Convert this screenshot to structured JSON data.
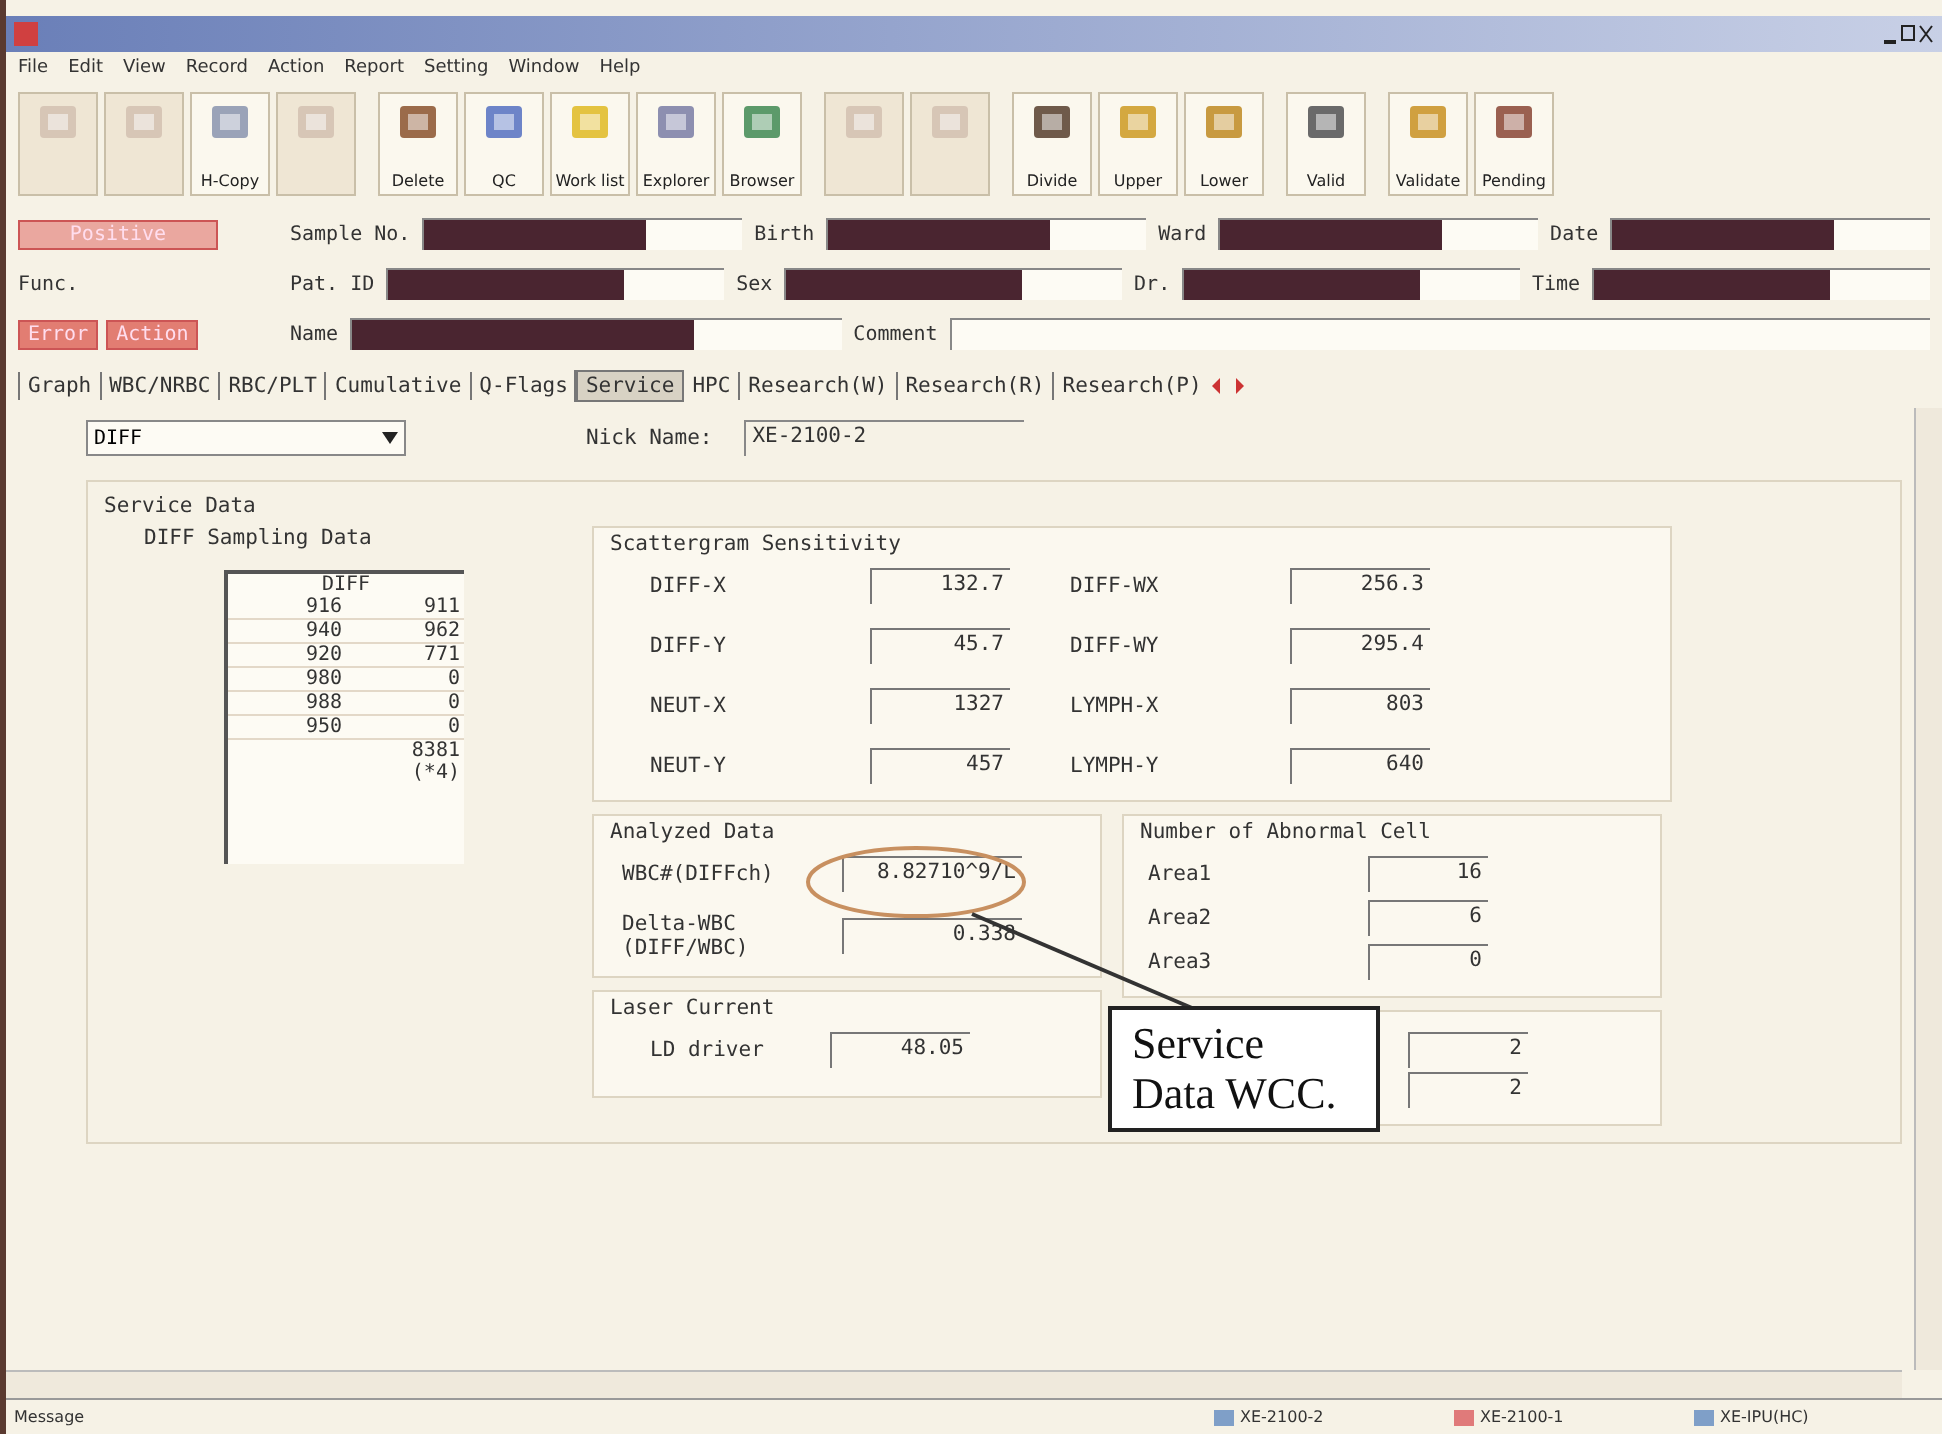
{
  "menu": [
    "File",
    "Edit",
    "View",
    "Record",
    "Action",
    "Report",
    "Setting",
    "Window",
    "Help"
  ],
  "toolbar": [
    {
      "disabled": true
    },
    {
      "disabled": true
    },
    {
      "label": "H-Copy",
      "disabled": false
    },
    {
      "disabled": true
    },
    {
      "label": "Delete",
      "disabled": false
    },
    {
      "label": "QC",
      "disabled": false
    },
    {
      "label": "Work list",
      "disabled": false
    },
    {
      "label": "Explorer",
      "disabled": false
    },
    {
      "label": "Browser",
      "disabled": false
    },
    {
      "disabled": true
    },
    {
      "disabled": true
    },
    {
      "label": "Divide",
      "disabled": false
    },
    {
      "label": "Upper",
      "disabled": false
    },
    {
      "label": "Lower",
      "disabled": false
    },
    {
      "label": "Valid",
      "disabled": false
    },
    {
      "label": "Validate",
      "disabled": false
    },
    {
      "label": "Pending",
      "disabled": false
    }
  ],
  "status_flag": "Positive",
  "func_label": "Func.",
  "action_buttons": [
    "Error",
    "Action"
  ],
  "header_rows": [
    [
      {
        "label": "Sample No.",
        "redacted": true
      },
      {
        "label": "Birth",
        "redacted": true
      },
      {
        "label": "Ward",
        "redacted": true
      },
      {
        "label": "Date",
        "redacted": true
      }
    ],
    [
      {
        "label": "Pat. ID",
        "redacted": true
      },
      {
        "label": "Sex",
        "redacted": true
      },
      {
        "label": "Dr.",
        "redacted": true
      },
      {
        "label": "Time",
        "redacted": true
      }
    ],
    [
      {
        "label": "Name",
        "redacted": true
      },
      {
        "label": "Comment",
        "redacted": false
      }
    ]
  ],
  "tabs": [
    {
      "label": "Graph",
      "selected": false
    },
    {
      "label": "WBC/NRBC",
      "selected": false
    },
    {
      "label": "RBC/PLT",
      "selected": false
    },
    {
      "label": "Cumulative",
      "selected": false
    },
    {
      "label": "Q-Flags",
      "selected": false
    },
    {
      "label": "Service",
      "selected": true
    },
    {
      "label": "HPC",
      "selected": false
    },
    {
      "label": "Research(W)",
      "selected": false
    },
    {
      "label": "Research(R)",
      "selected": false
    },
    {
      "label": "Research(P)",
      "selected": false
    }
  ],
  "channel_select": {
    "value": "DIFF"
  },
  "nick_name": {
    "label": "Nick Name:",
    "value": "XE-2100-2"
  },
  "service": {
    "title": "Service Data",
    "sampling": {
      "title": "DIFF Sampling Data",
      "header": "DIFF",
      "rows": [
        [
          "916",
          "911"
        ],
        [
          "940",
          "962"
        ],
        [
          "920",
          "771"
        ],
        [
          "980",
          "0"
        ],
        [
          "988",
          "0"
        ],
        [
          "950",
          "0"
        ]
      ],
      "total": "8381",
      "note": "(*4)"
    },
    "scattergram": {
      "title": "Scattergram Sensitivity",
      "fields": [
        {
          "label": "DIFF-X",
          "value": "132.7"
        },
        {
          "label": "DIFF-WX",
          "value": "256.3"
        },
        {
          "label": "DIFF-Y",
          "value": "45.7"
        },
        {
          "label": "DIFF-WY",
          "value": "295.4"
        },
        {
          "label": "NEUT-X",
          "value": "1327"
        },
        {
          "label": "LYMPH-X",
          "value": "803"
        },
        {
          "label": "NEUT-Y",
          "value": "457"
        },
        {
          "label": "LYMPH-Y",
          "value": "640"
        }
      ]
    },
    "analyzed": {
      "title": "Analyzed Data",
      "fields": [
        {
          "label": "WBC#(DIFFch)",
          "value": "8.82710^9/L"
        },
        {
          "label": "Delta-WBC (DIFF/WBC)",
          "value": "0.338"
        }
      ]
    },
    "abnormal": {
      "title": "Number of Abnormal Cell",
      "fields": [
        {
          "label": "Area1",
          "value": "16"
        },
        {
          "label": "Area2",
          "value": "6"
        },
        {
          "label": "Area3",
          "value": "0"
        }
      ]
    },
    "laser": {
      "title": "Laser Current",
      "fields": [
        {
          "label": "LD driver",
          "value": "48.05"
        }
      ]
    },
    "covered_fields": [
      "2",
      "2"
    ]
  },
  "annotation": {
    "text": "Service Data WCC."
  },
  "status_bar": {
    "message": "Message",
    "devices": [
      {
        "label": "XE-2100-2",
        "color": "#7f9fc8"
      },
      {
        "label": "XE-2100-1",
        "color": "#e07a7a"
      },
      {
        "label": "XE-IPU(HC)",
        "color": "#7f9fc8"
      }
    ]
  }
}
